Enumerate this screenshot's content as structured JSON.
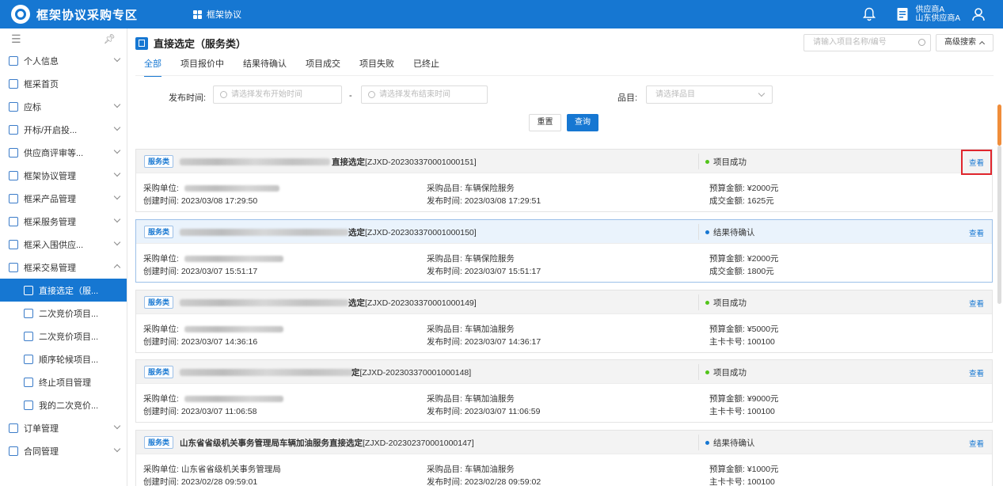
{
  "header": {
    "app_title": "框架协议采购专区",
    "nav_item": "框架协议",
    "user_role": "供应商A",
    "user_org": "山东供应商A"
  },
  "sidebar": {
    "items": [
      {
        "label": "个人信息",
        "chevron": "down"
      },
      {
        "label": "框采首页",
        "chevron": ""
      },
      {
        "label": "应标",
        "chevron": "down"
      },
      {
        "label": "开标/开启投...",
        "chevron": "down"
      },
      {
        "label": "供应商评审等...",
        "chevron": "down"
      },
      {
        "label": "框架协议管理",
        "chevron": "down"
      },
      {
        "label": "框采产品管理",
        "chevron": "down"
      },
      {
        "label": "框采服务管理",
        "chevron": "down"
      },
      {
        "label": "框采入围供应...",
        "chevron": "down"
      },
      {
        "label": "框采交易管理",
        "chevron": "up"
      }
    ],
    "sub_items": [
      {
        "label": "直接选定（服...",
        "active": true
      },
      {
        "label": "二次竞价项目...",
        "active": false
      },
      {
        "label": "二次竞价项目...",
        "active": false
      },
      {
        "label": "顺序轮候项目...",
        "active": false
      },
      {
        "label": "终止项目管理",
        "active": false
      },
      {
        "label": "我的二次竞价...",
        "active": false
      }
    ],
    "bottom_items": [
      {
        "label": "订单管理",
        "chevron": "down"
      },
      {
        "label": "合同管理",
        "chevron": "down"
      }
    ]
  },
  "page": {
    "title": "直接选定（服务类）",
    "search_placeholder": "请输入项目名称/编号",
    "advanced_search": "高级搜索"
  },
  "tabs": [
    "全部",
    "项目报价中",
    "结果待确认",
    "项目成交",
    "项目失败",
    "已终止"
  ],
  "filters": {
    "publish_time_label": "发布时间:",
    "start_placeholder": "请选择发布开始时间",
    "dash": "-",
    "end_placeholder": "请选择发布结束时间",
    "category_label": "品目:",
    "category_placeholder": "请选择品目",
    "reset": "重置",
    "query": "查询"
  },
  "labels": {
    "buyer": "采购单位:",
    "created": "创建时间:",
    "category": "采购品目:",
    "published": "发布时间:",
    "budget": "预算金额:",
    "view": "查看"
  },
  "cards": [
    {
      "tag": "服务类",
      "title": "直接选定",
      "code": "[ZJXD-202303370001000151]",
      "status": "项目成功",
      "status_color": "#52c41a",
      "buyer": "",
      "created": "2023/03/08 17:29:50",
      "category": "车辆保险服务",
      "published": "2023/03/08 17:29:51",
      "budget": "¥2000元",
      "extra_label": "成交金额:",
      "extra_value": "1625元"
    },
    {
      "tag": "服务类",
      "title": "选定",
      "code": "[ZJXD-202303370001000150]",
      "status": "结果待确认",
      "status_color": "#1677d2",
      "buyer": "",
      "created": "2023/03/07 15:51:17",
      "category": "车辆保险服务",
      "published": "2023/03/07 15:51:17",
      "budget": "¥2000元",
      "extra_label": "成交金额:",
      "extra_value": "1800元"
    },
    {
      "tag": "服务类",
      "title": "选定",
      "code": "[ZJXD-202303370001000149]",
      "status": "项目成功",
      "status_color": "#52c41a",
      "buyer": "",
      "created": "2023/03/07 14:36:16",
      "category": "车辆加油服务",
      "published": "2023/03/07 14:36:17",
      "budget": "¥5000元",
      "extra_label": "主卡卡号:",
      "extra_value": "100100"
    },
    {
      "tag": "服务类",
      "title": "定",
      "code": "[ZJXD-202303370001000148]",
      "status": "项目成功",
      "status_color": "#52c41a",
      "buyer": "",
      "created": "2023/03/07 11:06:58",
      "category": "车辆加油服务",
      "published": "2023/03/07 11:06:59",
      "budget": "¥9000元",
      "extra_label": "主卡卡号:",
      "extra_value": "100100"
    },
    {
      "tag": "服务类",
      "title": "山东省省级机关事务管理局车辆加油服务直接选定",
      "code": "[ZJXD-202302370001000147]",
      "status": "结果待确认",
      "status_color": "#1677d2",
      "buyer": "山东省省级机关事务管理局",
      "created": "2023/02/28 09:59:01",
      "category": "车辆加油服务",
      "published": "2023/02/28 09:59:02",
      "budget": "¥1000元",
      "extra_label": "主卡卡号:",
      "extra_value": "100100"
    }
  ]
}
